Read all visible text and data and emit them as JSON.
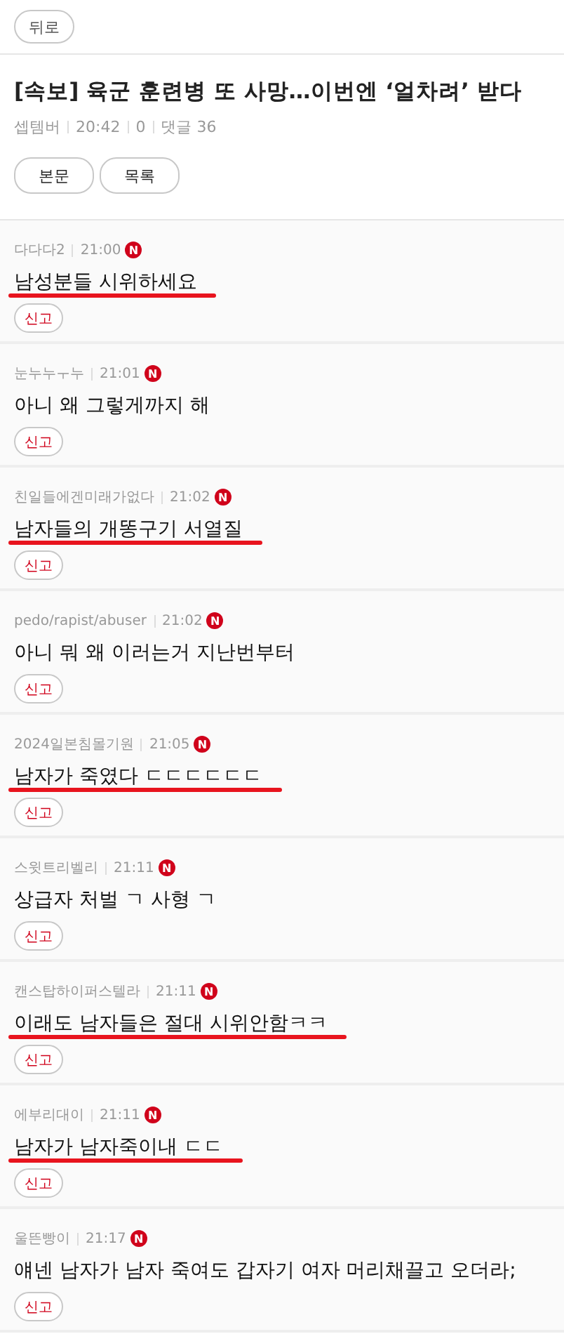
{
  "back_button": "뒤로",
  "post": {
    "title": "[속보] 육군 훈련병 또 사망…이번엔 ‘얼차려’ 받다",
    "author": "셉템버",
    "time": "20:42",
    "views": "0",
    "comments_label": "댓글 36"
  },
  "nav_buttons": [
    "본문",
    "목록"
  ],
  "comments": [
    {
      "author": "다다다2",
      "time": "21:00",
      "badge": "N",
      "text": "남성분들 시위하세요",
      "underlined": true,
      "report": "신고"
    },
    {
      "author": "눈누누ㅜ누",
      "time": "21:01",
      "badge": "N",
      "text": "아니 왜 그렇게까지 해",
      "underlined": false,
      "report": "신고"
    },
    {
      "author": "친일들에겐미래가없다",
      "time": "21:02",
      "badge": "N",
      "text": "남자들의 개똥구기 서열질",
      "underlined": true,
      "report": "신고"
    },
    {
      "author": "pedo/rapist/abuser",
      "time": "21:02",
      "badge": "N",
      "text": "아니 뭐 왜 이러는거 지난번부터",
      "underlined": false,
      "report": "신고"
    },
    {
      "author": "2024일본침몰기원",
      "time": "21:05",
      "badge": "N",
      "text": "남자가 죽였다 ㄷㄷㄷㄷㄷㄷ",
      "underlined": true,
      "report": "신고"
    },
    {
      "author": "스윗트리벨리",
      "time": "21:11",
      "badge": "N",
      "text": "상급자 처벌 ㄱ 사형 ㄱ",
      "underlined": false,
      "report": "신고"
    },
    {
      "author": "캔스탑하이퍼스텔라",
      "time": "21:11",
      "badge": "N",
      "text": "이래도 남자들은 절대 시위안함ㅋㅋ",
      "underlined": true,
      "report": "신고"
    },
    {
      "author": "에부리대이",
      "time": "21:11",
      "badge": "N",
      "text": "남자가 남자죽이내 ㄷㄷ",
      "underlined": true,
      "report": "신고"
    },
    {
      "author": "울뜬빵이",
      "time": "21:17",
      "badge": "N",
      "text": "얘넨 남자가 남자 죽여도 갑자기 여자 머리채끌고 오더라;",
      "underlined": false,
      "report": "신고"
    }
  ]
}
